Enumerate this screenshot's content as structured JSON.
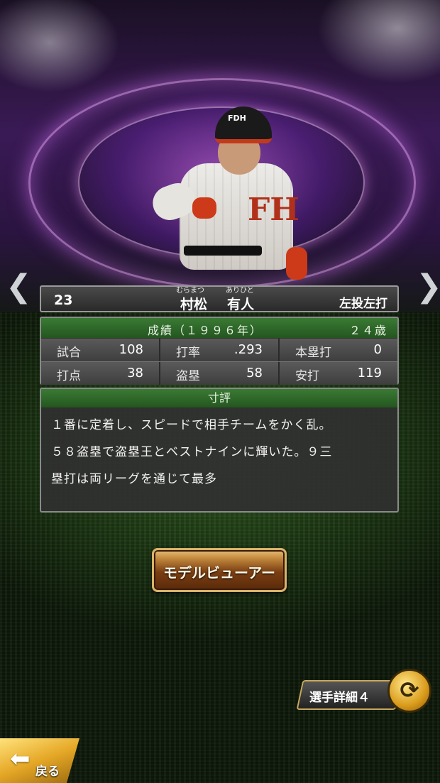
{
  "nav": {
    "prev_icon": "chevron-left-icon",
    "next_icon": "chevron-right-icon",
    "prev_glyph": "❮",
    "next_glyph": "❯"
  },
  "player": {
    "number": "23",
    "ruby_family": "むらまつ",
    "ruby_given": "ありひと",
    "family_name": "村松",
    "given_name": "有人",
    "handedness": "左投左打",
    "helmet_logo": "FDH",
    "uniform_mark": "FH"
  },
  "stats": {
    "title": "成績（１９９６年）",
    "age": "２４歳",
    "rows": [
      [
        {
          "label": "試合",
          "value": "108"
        },
        {
          "label": "打率",
          "value": ".293"
        },
        {
          "label": "本塁打",
          "value": "0"
        }
      ],
      [
        {
          "label": "打点",
          "value": "38"
        },
        {
          "label": "盗塁",
          "value": "58"
        },
        {
          "label": "安打",
          "value": "119"
        }
      ]
    ]
  },
  "comment": {
    "header": "寸評",
    "lines": [
      "１番に定着し、スピードで相手チームをかく乱。",
      "５８盗塁で盗塁王とベストナインに輝いた。９三",
      "塁打は両リーグを通じて最多"
    ]
  },
  "buttons": {
    "model_viewer": "モデルビューアー",
    "detail": "選手詳細４",
    "detail_icon_glyph": "⟳",
    "back": "戻る",
    "back_glyph": "⬅"
  },
  "colors": {
    "panel_header_green": "#2f6a2a",
    "button_brown": "#7a3e12",
    "gold": "#e5a726"
  }
}
